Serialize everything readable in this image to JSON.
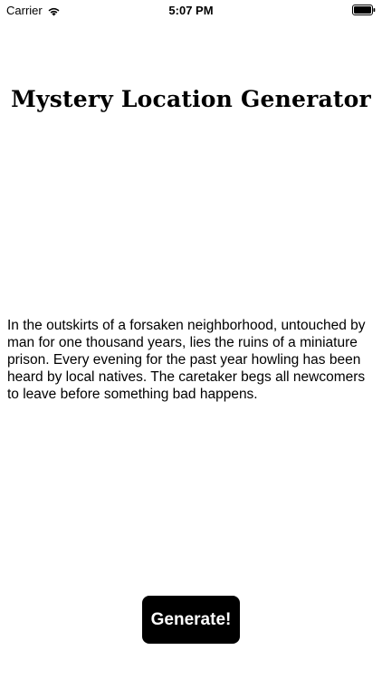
{
  "status_bar": {
    "carrier": "Carrier",
    "time": "5:07 PM",
    "wifi_icon": "wifi-icon",
    "battery_icon": "battery-icon"
  },
  "title": "Mystery Location Generator",
  "description": "In the outskirts of a forsaken neighborhood, untouched by man for one thousand years, lies the ruins of a miniature prison. Every evening for the past year howling has been heard by local natives. The caretaker begs all newcomers to leave before something bad happens.",
  "generate_button": {
    "label": "Generate!",
    "background": "#000000",
    "text_color": "#ffffff"
  }
}
